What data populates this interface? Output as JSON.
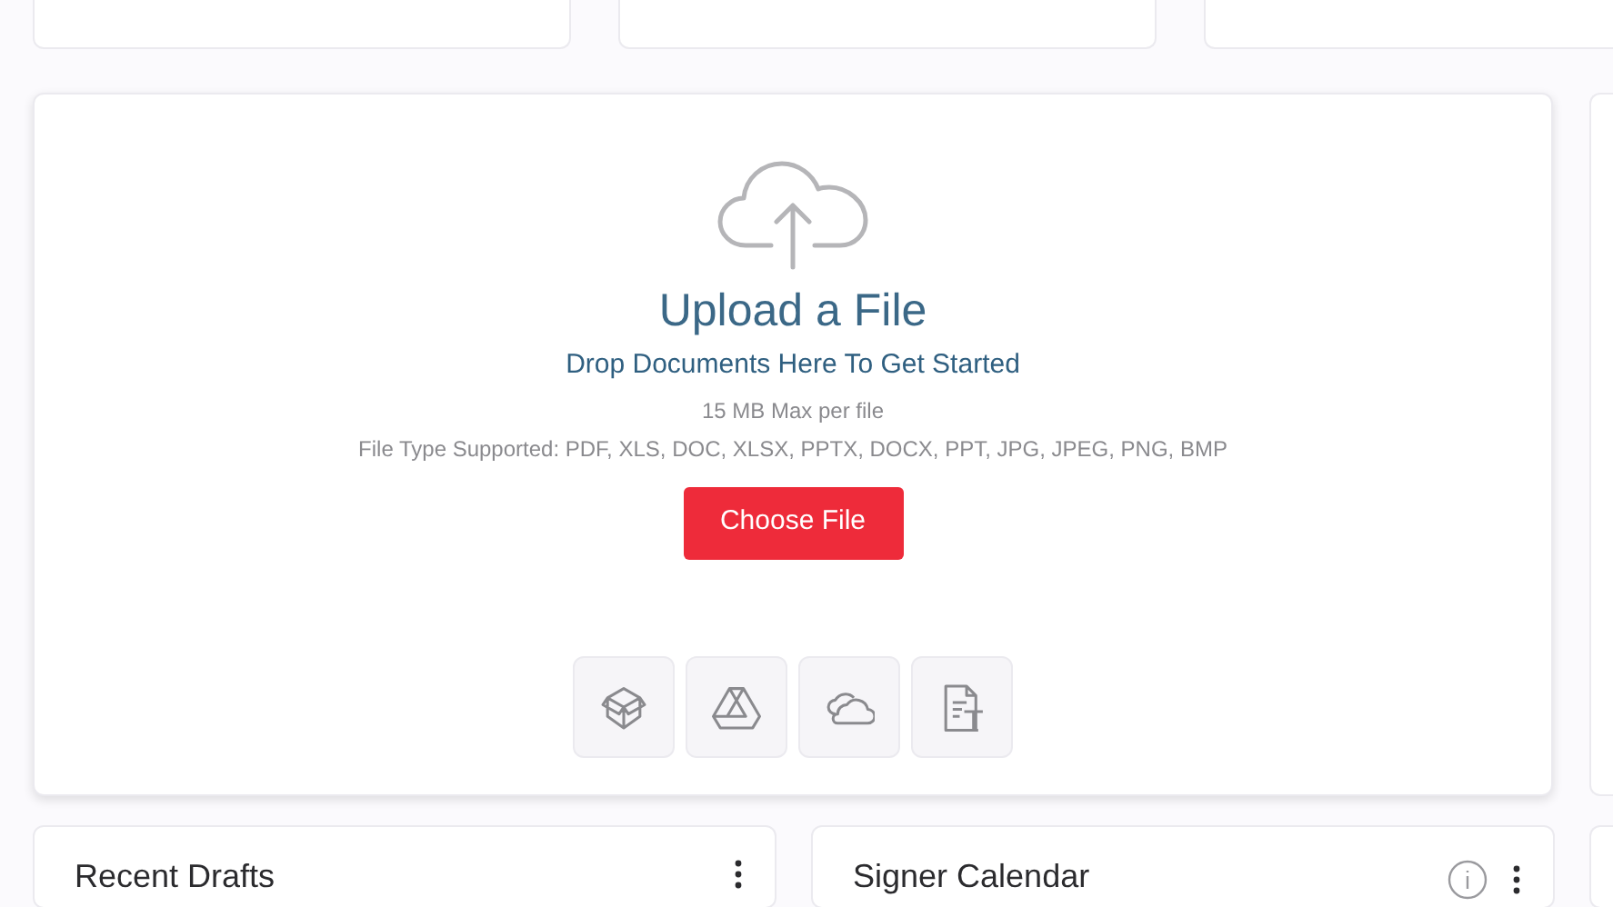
{
  "upload": {
    "title": "Upload a File",
    "subtitle": "Drop Documents Here To Get Started",
    "max_size": "15 MB Max per file",
    "file_types": "File Type Supported: PDF, XLS, DOC, XLSX, PPTX, DOCX, PPT, JPG, JPEG, PNG, BMP",
    "button": "Choose File",
    "sources": [
      {
        "kind": "box"
      },
      {
        "kind": "drive"
      },
      {
        "kind": "cloud"
      },
      {
        "kind": "template"
      }
    ]
  },
  "widgets": [
    {
      "title": "Recent Drafts",
      "info": false
    },
    {
      "title": "Signer Calendar",
      "info": true
    }
  ]
}
